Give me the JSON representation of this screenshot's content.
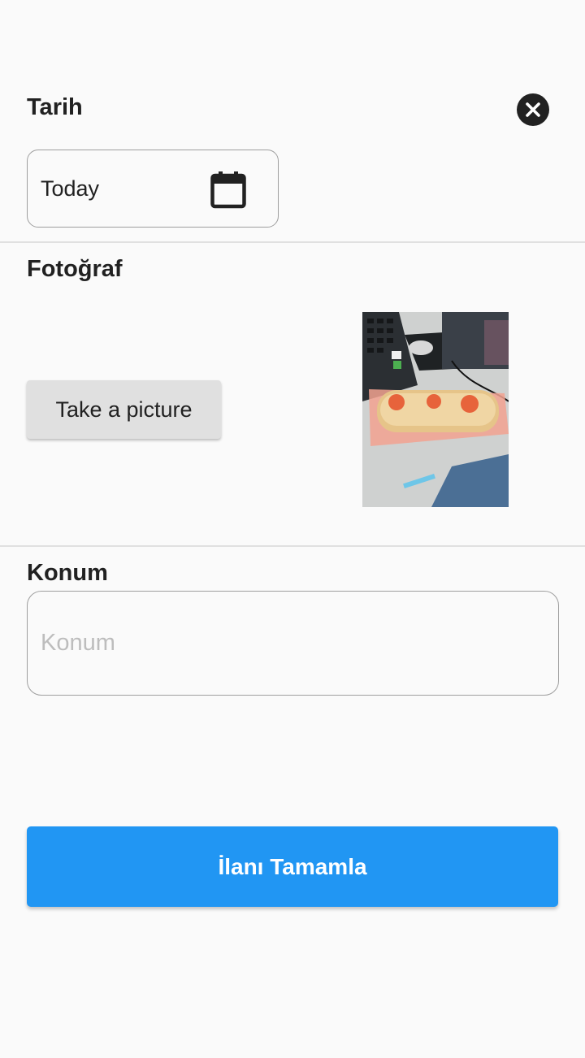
{
  "date_section": {
    "title": "Tarih",
    "value": "Today",
    "icon": "calendar-icon"
  },
  "close_button": {
    "icon": "close-icon"
  },
  "photo_section": {
    "title": "Fotoğraf",
    "take_picture_label": "Take a picture"
  },
  "location_section": {
    "title": "Konum",
    "placeholder": "Konum",
    "value": ""
  },
  "submit": {
    "label": "İlanı Tamamla"
  },
  "colors": {
    "accent": "#2196f3",
    "background": "#fafafa",
    "text": "#212121"
  }
}
